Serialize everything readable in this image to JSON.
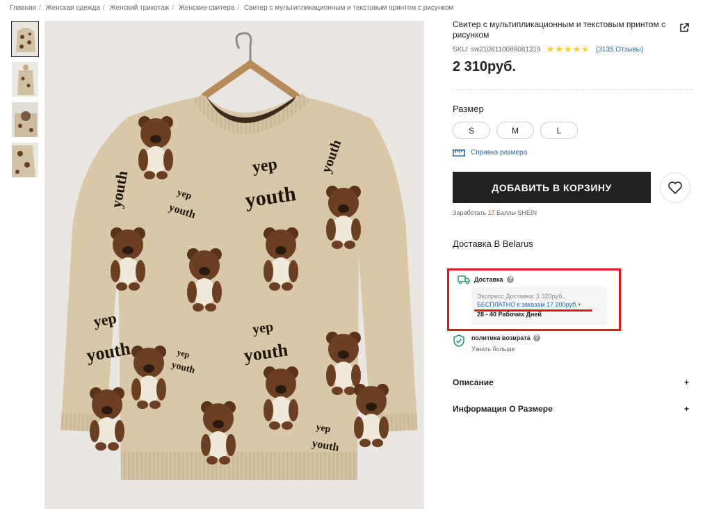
{
  "breadcrumb": [
    "Главная",
    "Женская одежда",
    "Женский трикотаж",
    "Женские свитера",
    "Свитер с мультипликационным и текстовым принтом с рисунком"
  ],
  "product": {
    "title": "Свитер с мультипликационным и текстовым принтом с рисунком",
    "sku": "SKU: sw2108110089081319",
    "rating": 4.5,
    "reviews": "(3135 Отзывы)",
    "price": "2 310руб."
  },
  "size": {
    "label": "Размер",
    "options": [
      "S",
      "M",
      "L"
    ],
    "help": "Справка размера"
  },
  "cart": {
    "add_label": "ДОБАВИТЬ В КОРЗИНУ",
    "points_prefix": "Заработать",
    "points_value": "17",
    "points_suffix": "Баллы SHEIN"
  },
  "delivery": {
    "heading": "Доставка В Belarus",
    "title": "Доставка",
    "express": "Экспресс Доставка: 3 320руб.,",
    "free": "БЕСПЛАТНО к заказам 17 200руб.+",
    "days": "28 - 40 Рабочих Дней"
  },
  "returns": {
    "title": "политика возврата",
    "more": "Узнать больше"
  },
  "accordion": {
    "description": "Описание",
    "size_info": "Информация О Размере",
    "expand": "+"
  },
  "colors": {
    "accent_red": "#e01a1a",
    "link_blue": "#2d68a8",
    "star_yellow": "#facf19",
    "return_green": "#1a9a6c"
  }
}
